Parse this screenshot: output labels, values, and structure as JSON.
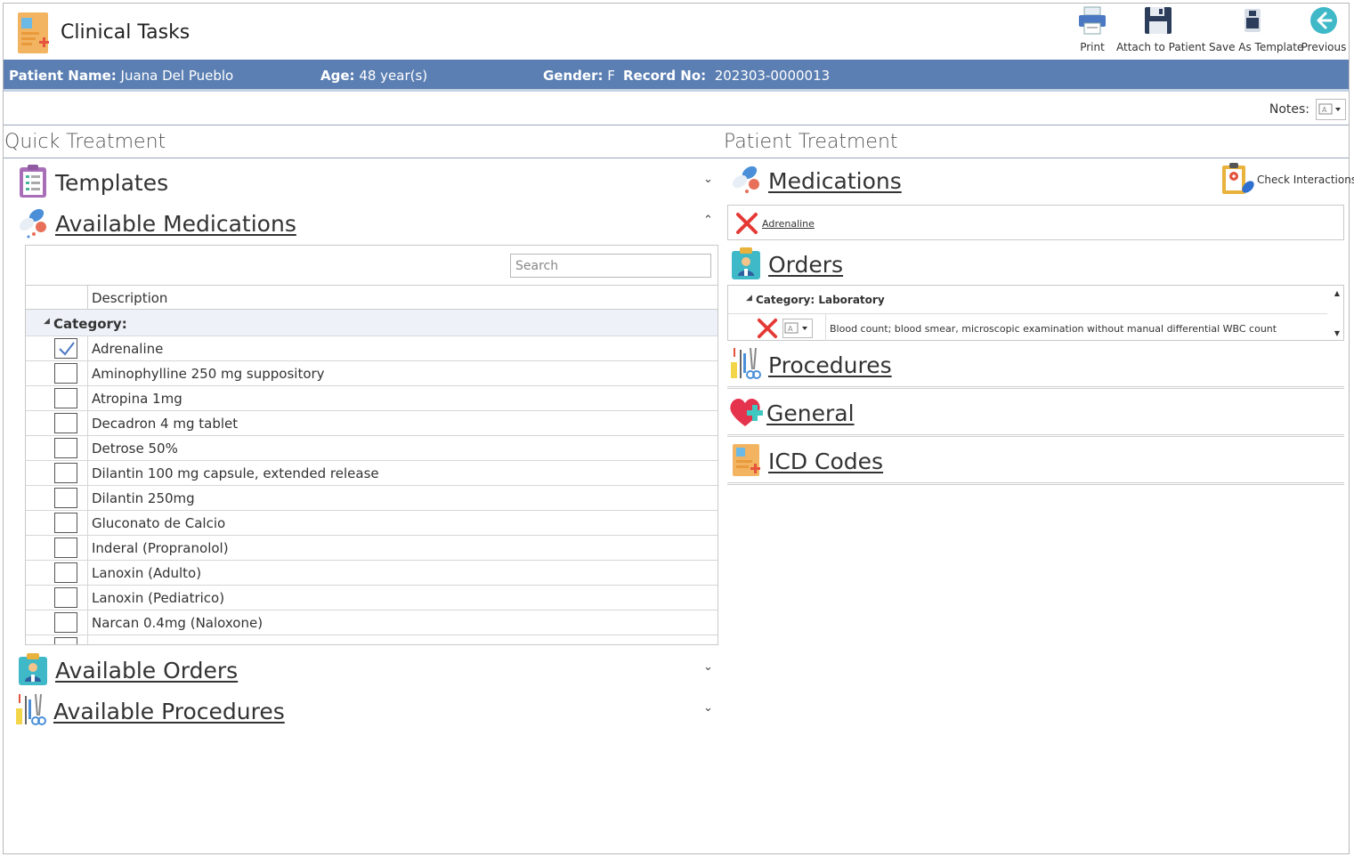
{
  "header": {
    "title": "Clinical Tasks",
    "toolbar": {
      "print": "Print",
      "attach": "Attach to Patient",
      "save_template": "Save As Template",
      "previous": "Previous"
    }
  },
  "patient": {
    "name_label": "Patient Name:",
    "name": "Juana Del Pueblo",
    "age_label": "Age:",
    "age": "48 year(s)",
    "gender_label": "Gender:",
    "gender": "F",
    "record_label": "Record No:",
    "record": "202303-0000013"
  },
  "notes": {
    "label": "Notes:"
  },
  "quick": {
    "title": "Quick Treatment",
    "templates": "Templates",
    "available_medications": "Available Medications",
    "search_placeholder": "Search",
    "column_description": "Description",
    "category": "Category:",
    "medications": [
      {
        "name": "Adrenaline",
        "checked": true
      },
      {
        "name": "Aminophylline 250 mg suppository",
        "checked": false
      },
      {
        "name": "Atropina 1mg",
        "checked": false
      },
      {
        "name": "Decadron 4 mg tablet",
        "checked": false
      },
      {
        "name": "Detrose 50%",
        "checked": false
      },
      {
        "name": "Dilantin 100 mg capsule, extended release",
        "checked": false
      },
      {
        "name": "Dilantin 250mg",
        "checked": false
      },
      {
        "name": "Gluconato de Calcio",
        "checked": false
      },
      {
        "name": "Inderal (Propranolol)",
        "checked": false
      },
      {
        "name": "Lanoxin (Adulto)",
        "checked": false
      },
      {
        "name": "Lanoxin (Pediatrico)",
        "checked": false
      },
      {
        "name": "Narcan 0.4mg (Naloxone)",
        "checked": false
      },
      {
        "name": "",
        "checked": false
      }
    ],
    "available_orders": "Available Orders",
    "available_procedures": "Available Procedures"
  },
  "patient_treatment": {
    "title": "Patient Treatment",
    "medications": "Medications",
    "check_interactions": "Check Interactions",
    "selected_medication": "Adrenaline",
    "orders": "Orders",
    "order_category": "Category: Laboratory",
    "order_item": "Blood count; blood smear, microscopic examination without manual differential WBC count",
    "procedures": "Procedures",
    "general": "General",
    "icd_codes": "ICD Codes"
  },
  "colors": {
    "patient_bar": "#5b7fb3",
    "delete_red": "#e53935",
    "check_blue": "#4a78c2"
  }
}
